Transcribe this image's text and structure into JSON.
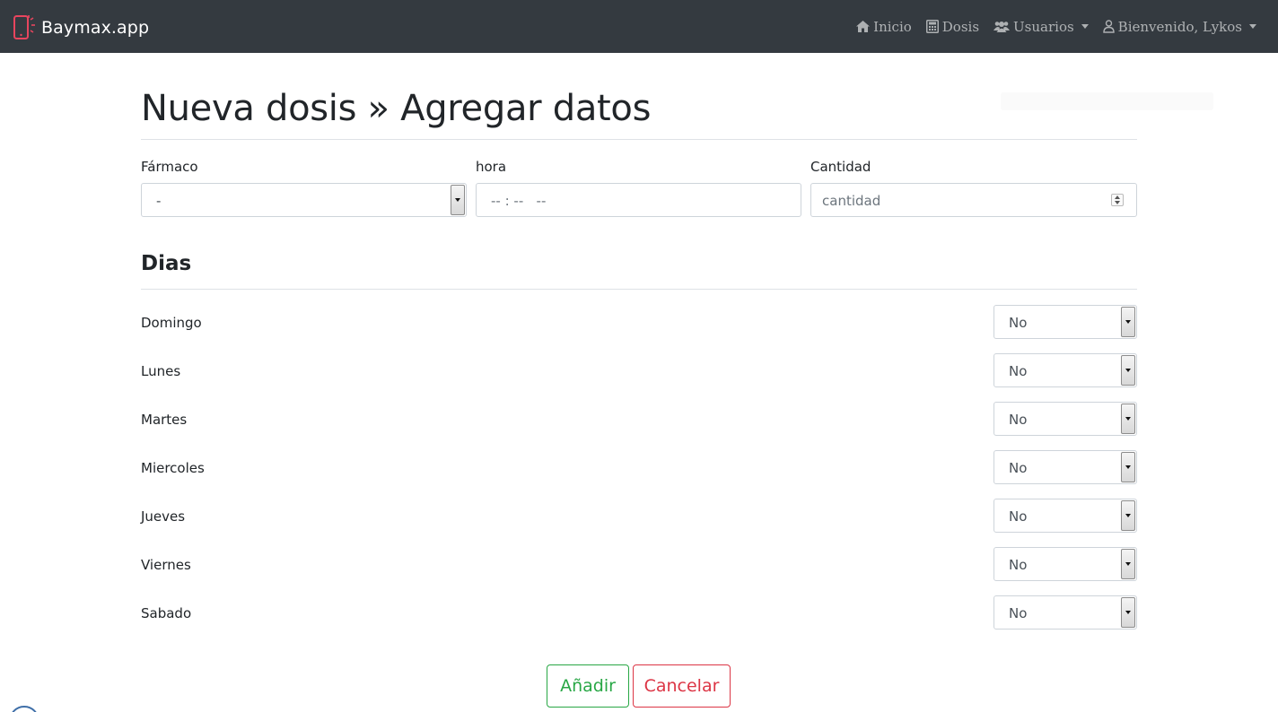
{
  "navbar": {
    "brand": "Baymax.app",
    "items": [
      {
        "label": "Inicio",
        "icon": "home-icon"
      },
      {
        "label": "Dosis",
        "icon": "calculator-icon"
      },
      {
        "label": "Usuarios",
        "icon": "users-icon",
        "dropdown": true
      },
      {
        "label": "Bienvenido, Lykos",
        "icon": "user-icon",
        "dropdown": true
      }
    ]
  },
  "page": {
    "title": "Nueva dosis » Agregar datos"
  },
  "form": {
    "farmaco": {
      "label": "Fármaco",
      "value": "-"
    },
    "hora": {
      "label": "hora",
      "value": "-- : --   --"
    },
    "cantidad": {
      "label": "Cantidad",
      "placeholder": "cantidad"
    }
  },
  "dias": {
    "title": "Dias",
    "items": [
      {
        "label": "Domingo",
        "value": "No"
      },
      {
        "label": "Lunes",
        "value": "No"
      },
      {
        "label": "Martes",
        "value": "No"
      },
      {
        "label": "Miercoles",
        "value": "No"
      },
      {
        "label": "Jueves",
        "value": "No"
      },
      {
        "label": "Viernes",
        "value": "No"
      },
      {
        "label": "Sabado",
        "value": "No"
      }
    ]
  },
  "actions": {
    "add": "Añadir",
    "cancel": "Cancelar"
  },
  "colors": {
    "navbar_bg": "#343a40",
    "brand_icon": "#e8455e",
    "success": "#28a745",
    "danger": "#dc3545"
  }
}
